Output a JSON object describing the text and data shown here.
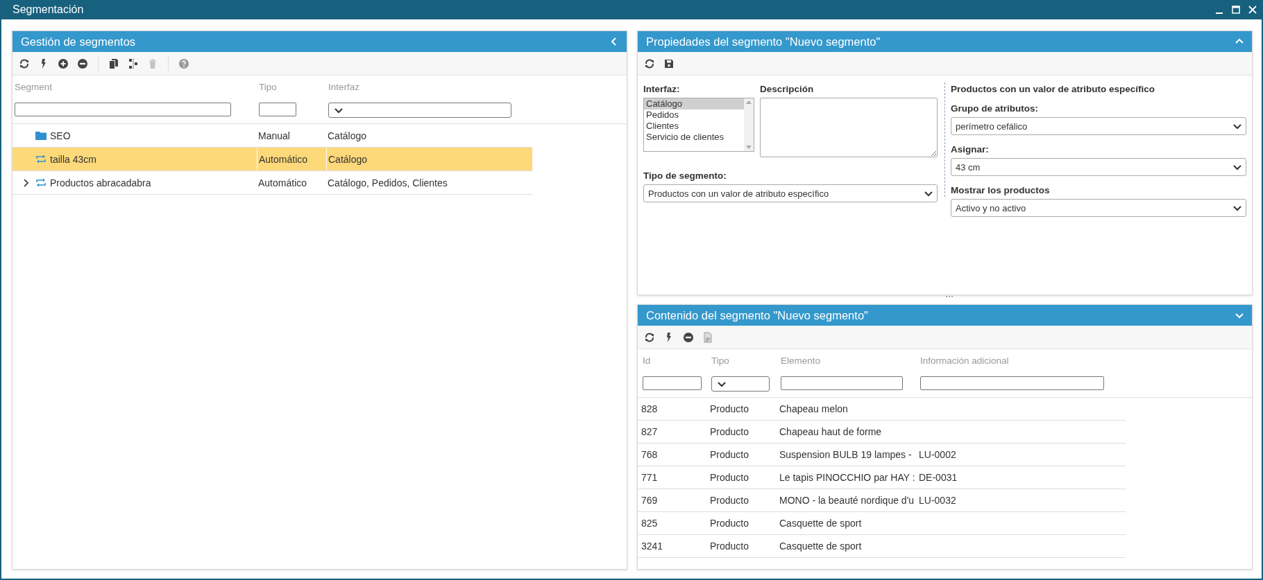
{
  "window": {
    "title": "Segmentación"
  },
  "segments_panel": {
    "title": "Gestión de segmentos",
    "toolbar": [
      {
        "kind": "refresh",
        "disabled": false
      },
      {
        "kind": "bolt",
        "disabled": false
      },
      {
        "kind": "add",
        "disabled": false
      },
      {
        "kind": "remove",
        "disabled": false
      },
      {
        "kind": "sep"
      },
      {
        "kind": "copy",
        "disabled": false
      },
      {
        "kind": "split",
        "disabled": false
      },
      {
        "kind": "trash",
        "disabled": true
      },
      {
        "kind": "sep"
      },
      {
        "kind": "help",
        "disabled": false
      }
    ],
    "columns": [
      {
        "label": "Segment",
        "kind": "text"
      },
      {
        "label": "Tipo",
        "kind": "text"
      },
      {
        "label": "Interfaz",
        "kind": "select"
      }
    ],
    "rows": [
      {
        "kind": "folder",
        "has_children": false,
        "name": "SEO",
        "tipo": "Manual",
        "interfaz": "Catálogo",
        "selected": false
      },
      {
        "kind": "automatic",
        "has_children": false,
        "name": "tailla 43cm",
        "tipo": "Automático",
        "interfaz": "Catálogo",
        "selected": true
      },
      {
        "kind": "automatic",
        "has_children": true,
        "name": "Productos abracadabra",
        "tipo": "Automático",
        "interfaz": "Catálogo, Pedidos, Clientes",
        "selected": false
      }
    ]
  },
  "properties_panel": {
    "title": "Propiedades del segmento \"Nuevo segmento\"",
    "toolbar": [
      {
        "kind": "refresh",
        "disabled": false
      },
      {
        "kind": "save",
        "disabled": false
      }
    ],
    "interfaz": {
      "label": "Interfaz:",
      "options": [
        {
          "label": "Catálogo",
          "selected": true
        },
        {
          "label": "Pedidos",
          "selected": false
        },
        {
          "label": "Clientes",
          "selected": false
        },
        {
          "label": "Servicio de clientes",
          "selected": false
        }
      ]
    },
    "descripcion": {
      "label": "Descripción"
    },
    "tipo_segmento": {
      "label": "Tipo de segmento:",
      "value": "Productos con un valor de atributo específico"
    },
    "criteria": {
      "title": "Productos con un valor de atributo específico",
      "fields": [
        {
          "label": "Grupo de atributos:",
          "value": "perímetro cefálico"
        },
        {
          "label": "Asignar:",
          "value": "43 cm"
        },
        {
          "label": "Mostrar los productos",
          "value": "Activo y no activo"
        }
      ]
    }
  },
  "content_panel": {
    "title": "Contenido del segmento \"Nuevo segmento\"",
    "toolbar": [
      {
        "kind": "refresh",
        "disabled": false
      },
      {
        "kind": "bolt",
        "disabled": false
      },
      {
        "kind": "remove",
        "disabled": false
      },
      {
        "kind": "csv",
        "disabled": false
      }
    ],
    "columns": [
      {
        "label": "Id",
        "kind": "text"
      },
      {
        "label": "Tipo",
        "kind": "select"
      },
      {
        "label": "Elemento",
        "kind": "text"
      },
      {
        "label": "Información adicional",
        "kind": "text"
      }
    ],
    "rows": [
      {
        "id": "828",
        "tipo": "Producto",
        "elemento": "Chapeau melon"
      },
      {
        "id": "827",
        "tipo": "Producto",
        "elemento": "Chapeau haut de forme"
      },
      {
        "id": "768",
        "tipo": "Producto",
        "elemento": "Suspension BULB 19 lampes -",
        "info": "LU-0002"
      },
      {
        "id": "771",
        "tipo": "Producto",
        "elemento": "Le tapis PINOCCHIO par HAY :",
        "info": "DE-0031"
      },
      {
        "id": "769",
        "tipo": "Producto",
        "elemento": "MONO - la beauté nordique d'u",
        "info": "LU-0032"
      },
      {
        "id": "825",
        "tipo": "Producto",
        "elemento": "Casquette de sport"
      },
      {
        "id": "3241",
        "tipo": "Producto",
        "elemento": "Casquette de sport"
      }
    ]
  }
}
